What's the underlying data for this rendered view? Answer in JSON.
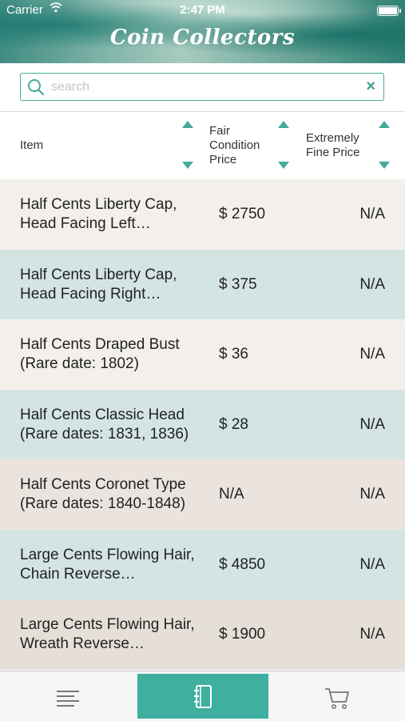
{
  "status_bar": {
    "carrier": "Carrier",
    "time": "2:47 PM"
  },
  "header": {
    "title": "Coin Collectors"
  },
  "search": {
    "placeholder": "search",
    "clear_label": "×"
  },
  "columns": [
    {
      "label": "Item"
    },
    {
      "label": "Fair Condition Price"
    },
    {
      "label": "Extremely Fine Price"
    }
  ],
  "rows": [
    {
      "item": "Half Cents Liberty Cap, Head Facing Left…",
      "fair": "$ 2750",
      "xf": "N/A",
      "bg": "#f3f0ec"
    },
    {
      "item": "Half Cents Liberty Cap, Head Facing Right…",
      "fair": "$ 375",
      "xf": "N/A",
      "bg": "#d3e4e3"
    },
    {
      "item": "Half Cents Draped Bust (Rare date: 1802)",
      "fair": "$ 36",
      "xf": "N/A",
      "bg": "#f3f0ec"
    },
    {
      "item": "Half Cents Classic Head (Rare dates: 1831, 1836)",
      "fair": "$ 28",
      "xf": "N/A",
      "bg": "#d3e4e3"
    },
    {
      "item": "Half Cents Coronet Type (Rare dates: 1840-1848)",
      "fair": "N/A",
      "xf": "N/A",
      "bg": "#ebe4de"
    },
    {
      "item": "Large Cents Flowing Hair, Chain Reverse…",
      "fair": "$ 4850",
      "xf": "N/A",
      "bg": "#d3e4e3"
    },
    {
      "item": "Large Cents Flowing Hair, Wreath Reverse…",
      "fair": "$ 1900",
      "xf": "N/A",
      "bg": "#e6dfd8"
    }
  ],
  "tabs": [
    {
      "icon": "list-icon",
      "active": false
    },
    {
      "icon": "notebook-icon",
      "active": true
    },
    {
      "icon": "cart-icon",
      "active": false
    }
  ],
  "colors": {
    "accent": "#45aa9a",
    "tab_active": "#3fb0a0"
  }
}
